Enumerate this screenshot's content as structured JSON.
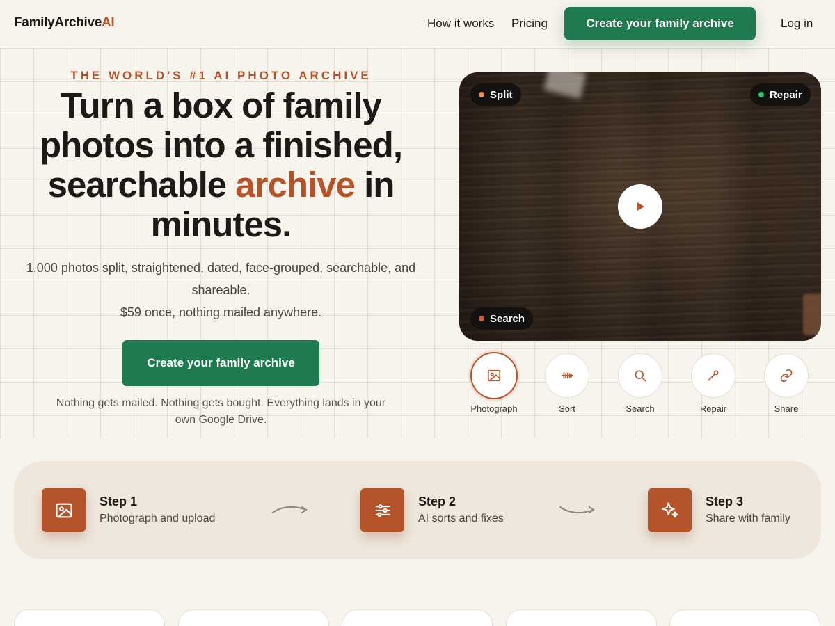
{
  "brand": {
    "name": "FamilyArchive",
    "suffix": "AI"
  },
  "nav": {
    "links": [
      "How it works",
      "Pricing"
    ],
    "cta": "Create your family archive",
    "login": "Log in"
  },
  "hero": {
    "eyebrow": "THE WORLD'S #1 AI PHOTO ARCHIVE",
    "headline_before": "Turn a box of family photos into a finished, searchable ",
    "headline_accent": "archive",
    "headline_after": " in minutes.",
    "sub_line1": "1,000 photos split, straightened, dated, face-grouped, searchable, and shareable.",
    "sub_line2": "$59 once, nothing mailed anywhere.",
    "cta": "Create your family archive",
    "note": "Nothing gets mailed. Nothing gets bought. Everything lands in your own Google Drive."
  },
  "video": {
    "pills": [
      {
        "label": "Split",
        "dot_color": "#f08a5d"
      },
      {
        "label": "Repair",
        "dot_color": "#33c46b"
      },
      {
        "label": "Search",
        "dot_color": "#d0573b"
      }
    ],
    "play_icon": "play-icon"
  },
  "features": [
    {
      "label": "Photograph",
      "icon": "image-icon",
      "active": true
    },
    {
      "label": "Sort",
      "icon": "sort-icon",
      "active": false
    },
    {
      "label": "Search",
      "icon": "search-icon",
      "active": false
    },
    {
      "label": "Repair",
      "icon": "wand-icon",
      "active": false
    },
    {
      "label": "Share",
      "icon": "link-icon",
      "active": false
    }
  ],
  "steps": [
    {
      "title": "Step 1",
      "desc": "Photograph and upload",
      "icon": "image-icon"
    },
    {
      "title": "Step 2",
      "desc": "AI sorts and fixes",
      "icon": "sliders-icon"
    },
    {
      "title": "Step 3",
      "desc": "Share with family",
      "icon": "sparkles-icon"
    }
  ],
  "colors": {
    "accent": "#b5532b",
    "primary": "#1f7a4f",
    "background": "#f7f3ed"
  }
}
